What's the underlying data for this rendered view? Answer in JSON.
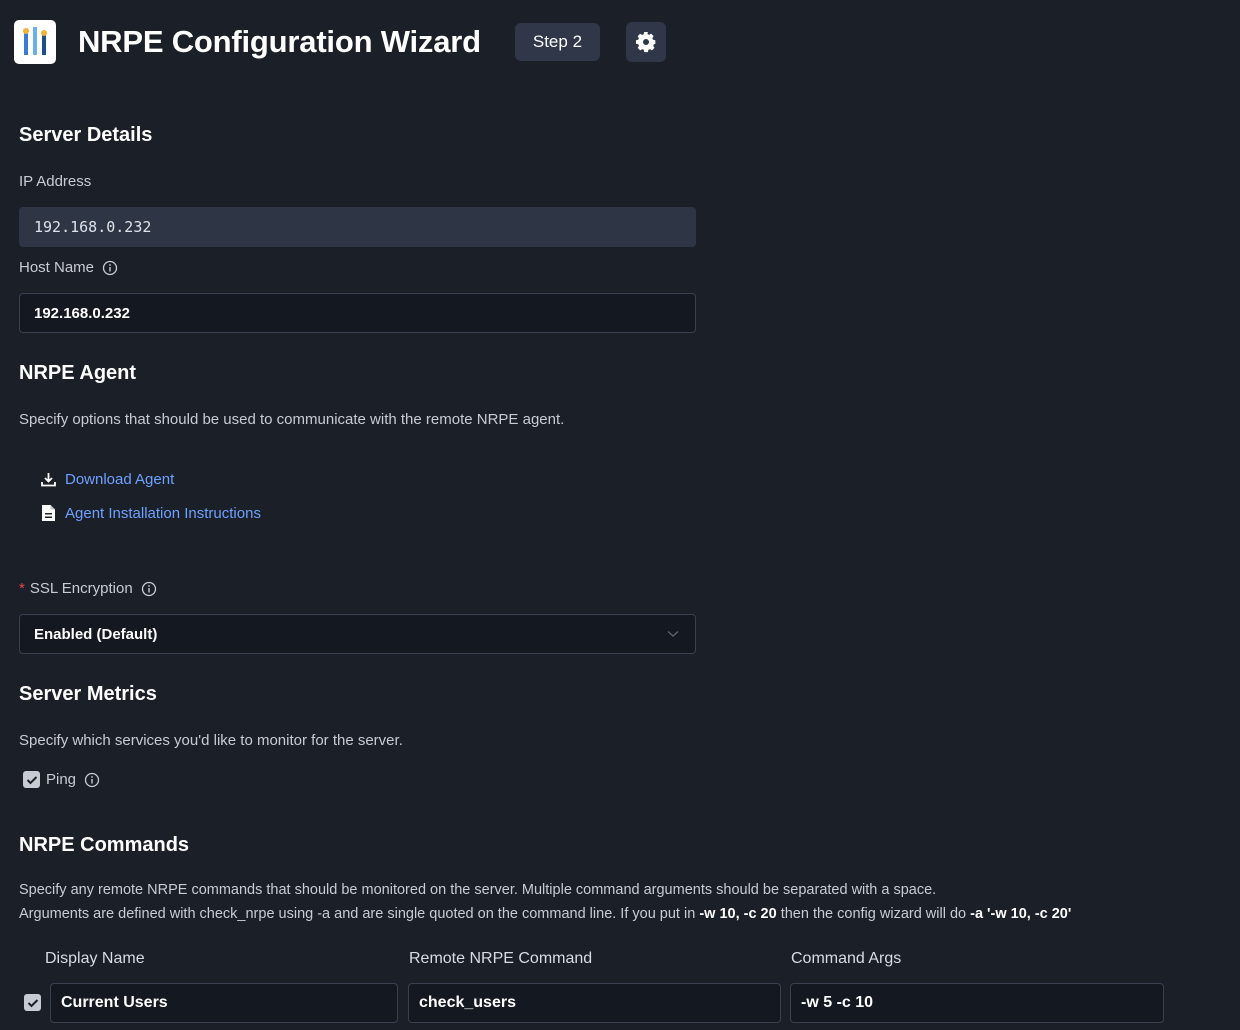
{
  "header": {
    "title": "NRPE Configuration Wizard",
    "step_label": "Step 2",
    "logo_icon": "nrpe-logo-icon",
    "settings_icon": "gear-icon"
  },
  "server_details": {
    "heading": "Server Details",
    "ip_label": "IP Address",
    "ip_value": "192.168.0.232",
    "host_label": "Host Name",
    "host_value": "192.168.0.232"
  },
  "nrpe_agent": {
    "heading": "NRPE Agent",
    "description": "Specify options that should be used to communicate with the remote NRPE agent.",
    "download_link": "Download Agent",
    "instructions_link": "Agent Installation Instructions",
    "ssl_required_mark": "*",
    "ssl_label": "SSL Encryption",
    "ssl_value": "Enabled (Default)"
  },
  "server_metrics": {
    "heading": "Server Metrics",
    "description": "Specify which services you'd like to monitor for the server.",
    "ping_label": "Ping",
    "ping_checked": true
  },
  "nrpe_commands": {
    "heading": "NRPE Commands",
    "desc_line1": "Specify any remote NRPE commands that should be monitored on the server. Multiple command arguments should be separated with a space.",
    "desc_line2_a": "Arguments are defined with check_nrpe using -a and are single quoted on the command line. If you put in ",
    "desc_line2_b": "-w 10, -c 20",
    "desc_line2_c": " then the config wizard will do ",
    "desc_line2_d": "-a '-w 10, -c 20'",
    "columns": [
      "Display Name",
      "Remote NRPE Command",
      "Command Args"
    ],
    "rows": [
      {
        "checked": true,
        "display_name": "Current Users",
        "command": "check_users",
        "args": "-w 5 -c 10"
      }
    ]
  },
  "colors": {
    "background": "#1b1f27",
    "link": "#6ea0ff",
    "required": "#e5484d",
    "badge": "#2f3748"
  }
}
